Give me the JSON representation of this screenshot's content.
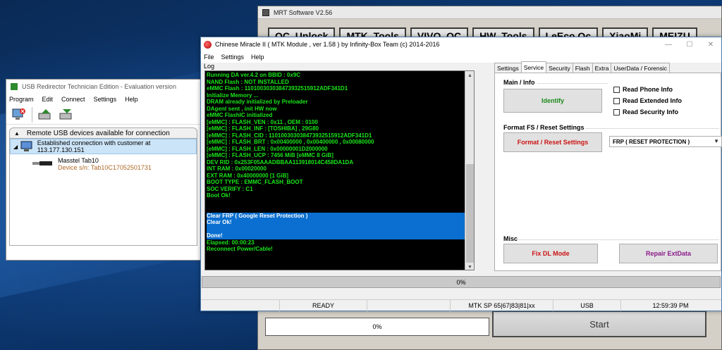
{
  "mrt": {
    "title": "MRT Software V2.56",
    "tabs": [
      "QC_Unlock",
      "MTK_Tools",
      "VIVO_QC",
      "HW_Tools",
      "LeEco Qc",
      "XiaoMi",
      "MEIZU"
    ],
    "progress": "0%",
    "start_label": "Start"
  },
  "usb": {
    "title": "USB Redirector Technician Edition - Evaluation version",
    "menu": [
      "Program",
      "Edit",
      "Connect",
      "Settings",
      "Help"
    ],
    "header": "Remote USB devices available for connection",
    "connection": "Established connection with customer at 113.177.130.151",
    "device_name": "Masstel Tab10",
    "device_serial": "Device s/n: Tab10C17052501731"
  },
  "cm": {
    "title": "Chinese Miracle II ( MTK Module , ver 1.58 ) by Infinity-Box Team (c) 2014-2016",
    "menu": [
      "File",
      "Settings",
      "Help"
    ],
    "log_label": "Log",
    "log_lines": [
      "Running DA ver.4.2 on BBID : 0x9C",
      "NAND Flash : NOT INSTALLED",
      "eMMC Flash : 110100303038473932515912ADF341D1",
      "Initialize Memory ...",
      "DRAM already initialized by Preloader",
      "DAgent sent , init HW now",
      "eMMC FlashIC initialized",
      "[eMMC] : FLASH_VEN : 0x11 , OEM : 0100",
      "[eMMC] : FLASH_INF : [TOSHIBA] , 29G80",
      "[eMMC] : FLASH_CID : 110100303038473932515912ADF341D1",
      "[eMMC] : FLASH_BRT : 0x00400000 , 0x00400000 , 0x00080000",
      "[eMMC] : FLASH_LEN : 0x00000001D2000000",
      "[eMMC] : FLASH_UCP : 7456 MiB [eMMC 8 GiB]",
      "DEV RID    : 0x253F05AAADBBAA113918014C458DA1DA",
      "INT RAM    : 0x00020000",
      "EXT RAM    : 0x40000000 [1 GiB]",
      "BOOT TYPE  : EMMC_FLASH_BOOT",
      "SOC VERIFY : C1",
      "Boot Ok!",
      "",
      "",
      "Clear FRP ( Google Reset Protection )",
      "Clear Ok!",
      "",
      "Done!",
      "Elapsed: 00:00:23",
      "Reconnect Power/Cable!"
    ],
    "tabs": [
      "Settings",
      "Service",
      "Security",
      "Flash",
      "Extra",
      "UserData / Forensic"
    ],
    "main_info_title": "Main / Info",
    "identify_label": "Identify",
    "checks": [
      "Read Phone Info",
      "Read Extended Info",
      "Read Security Info"
    ],
    "format_title": "Format FS / Reset Settings",
    "format_label": "Format / Reset Settings",
    "combo_value": "FRP ( RESET PROTECTION )",
    "misc_title": "Misc",
    "fix_dl_label": "Fix DL Mode",
    "repair_label": "Repair ExtData",
    "progress": "0%",
    "status": {
      "state": "READY",
      "device": "MTK SP 65|67|83|81|xx",
      "port": "USB",
      "time": "12:59:39 PM"
    }
  },
  "colors": {
    "log_text": "#19e619",
    "highlight": "#0a6fd0",
    "identify": "#1a8a1a",
    "format": "#cc1111",
    "fix_dl": "#cc1111",
    "repair": "#8a1a8a"
  }
}
